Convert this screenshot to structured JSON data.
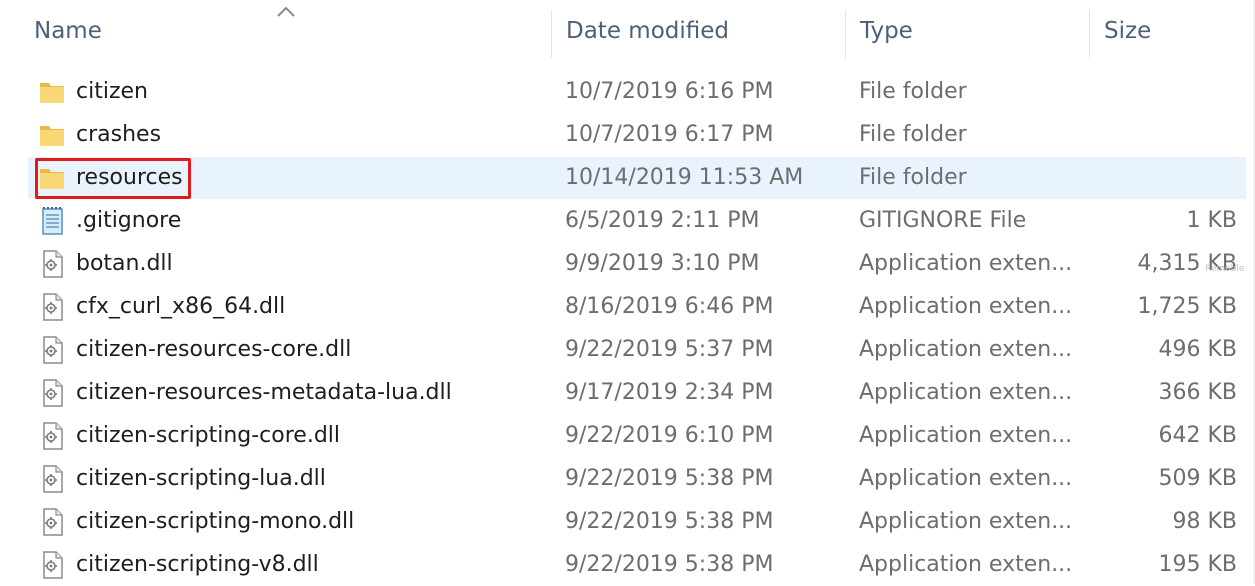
{
  "columns": {
    "name": "Name",
    "date_modified": "Date modified",
    "type": "Type",
    "size": "Size"
  },
  "files": [
    {
      "name": "citizen",
      "date": "10/7/2019 6:16 PM",
      "type": "File folder",
      "size": "",
      "icon": "folder-icon"
    },
    {
      "name": "crashes",
      "date": "10/7/2019 6:17 PM",
      "type": "File folder",
      "size": "",
      "icon": "folder-icon"
    },
    {
      "name": "resources",
      "date": "10/14/2019 11:53 AM",
      "type": "File folder",
      "size": "",
      "icon": "folder-icon",
      "selected": true
    },
    {
      "name": ".gitignore",
      "date": "6/5/2019 2:11 PM",
      "type": "GITIGNORE File",
      "size": "1 KB",
      "icon": "notepad-file-icon"
    },
    {
      "name": "botan.dll",
      "date": "9/9/2019 3:10 PM",
      "type": "Application exten...",
      "size": "4,315 KB",
      "icon": "dll-file-icon"
    },
    {
      "name": "cfx_curl_x86_64.dll",
      "date": "8/16/2019 6:46 PM",
      "type": "Application exten...",
      "size": "1,725 KB",
      "icon": "dll-file-icon"
    },
    {
      "name": "citizen-resources-core.dll",
      "date": "9/22/2019 5:37 PM",
      "type": "Application exten...",
      "size": "496 KB",
      "icon": "dll-file-icon"
    },
    {
      "name": "citizen-resources-metadata-lua.dll",
      "date": "9/17/2019 2:34 PM",
      "type": "Application exten...",
      "size": "366 KB",
      "icon": "dll-file-icon"
    },
    {
      "name": "citizen-scripting-core.dll",
      "date": "9/22/2019 6:10 PM",
      "type": "Application exten...",
      "size": "642 KB",
      "icon": "dll-file-icon"
    },
    {
      "name": "citizen-scripting-lua.dll",
      "date": "9/22/2019 5:38 PM",
      "type": "Application exten...",
      "size": "509 KB",
      "icon": "dll-file-icon"
    },
    {
      "name": "citizen-scripting-mono.dll",
      "date": "9/22/2019 5:38 PM",
      "type": "Application exten...",
      "size": "98 KB",
      "icon": "dll-file-icon"
    },
    {
      "name": "citizen-scripting-v8.dll",
      "date": "9/22/2019 5:38 PM",
      "type": "Application exten...",
      "size": "195 KB",
      "icon": "dll-file-icon"
    }
  ],
  "watermark": "Remoble",
  "colors": {
    "selection": "#e8f3fd",
    "highlight_border": "#e01b1b",
    "header_text": "#4c607a",
    "folder": "#f8d775"
  }
}
